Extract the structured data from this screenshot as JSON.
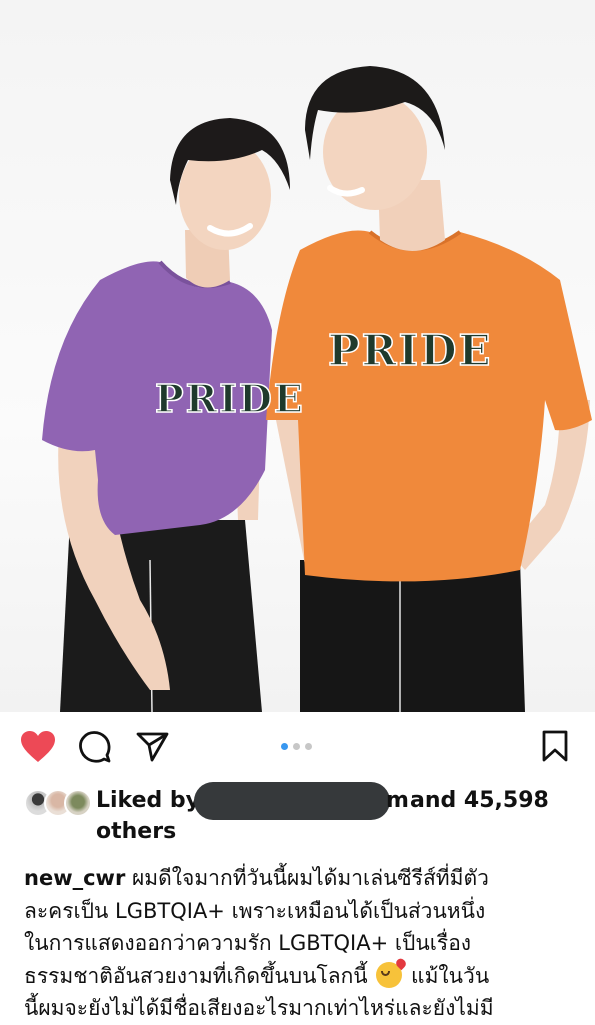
{
  "post": {
    "image_alt": "Two young men in PRIDE t-shirts",
    "shirt_print": "PRIDE",
    "carousel": {
      "total": 3,
      "active": 1
    }
  },
  "actions": {
    "like": "heart-icon",
    "comment": "comment-icon",
    "share": "share-icon",
    "save": "bookmark-icon",
    "like_color": "#ed4956"
  },
  "likes": {
    "prefix": "Liked by",
    "visible_name_tail": "m",
    "and_text": "and 45,598",
    "others_text": "others"
  },
  "caption": {
    "username": "new_cwr",
    "line1": "ผมดีใจมากที่วันนี้ผมได้มาเล่นซีรีส์ที่มีตัว",
    "line2": "ละครเป็น LGBTQIA+ เพราะเหมือนได้เป็นส่วนหนึ่ง",
    "line3": "ในการแสดงออกว่าความรัก LGBTQIA+ เป็นเรื่อง",
    "line4_a": "ธรรมชาติอันสวยงามที่เกิดขึ้นบนโลกนี้",
    "line4_b": "แม้ในวัน",
    "line5": "นี้ผมจะยังไม่ได้มีชื่อเสียงอะไรมากเท่าไหร่และยังไม่มี",
    "emoji": "smiling-face-with-hearts-emoji"
  }
}
